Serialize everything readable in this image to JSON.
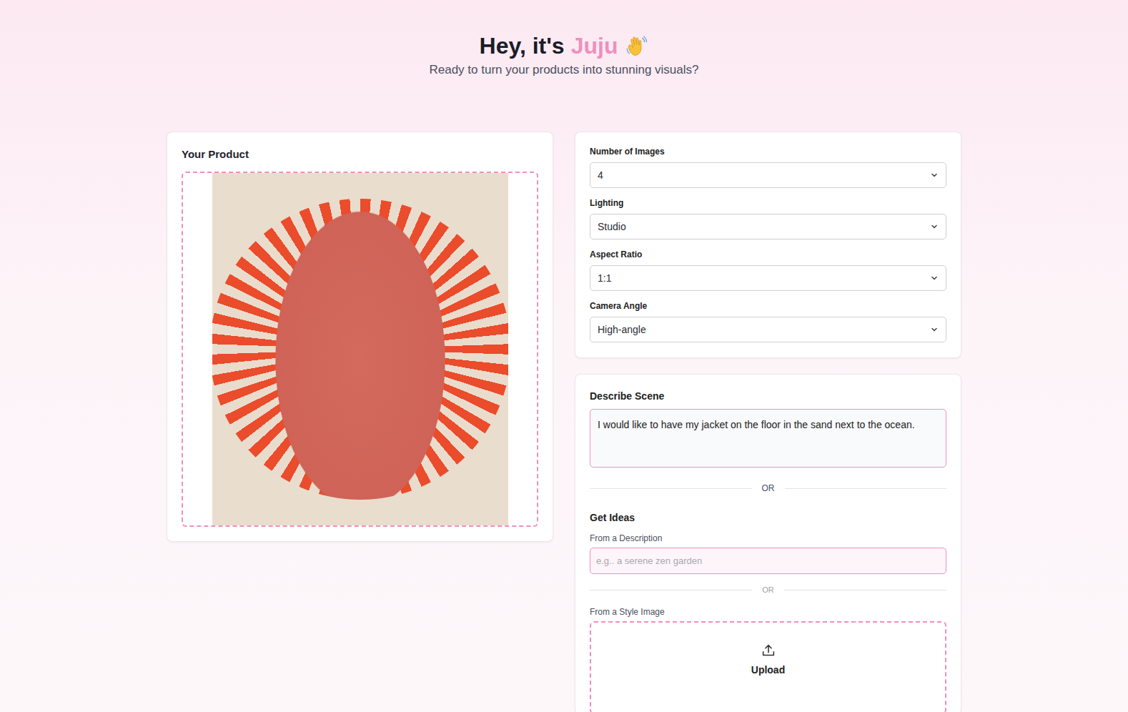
{
  "header": {
    "greeting": "Hey, it's",
    "name": "Juju",
    "subtitle": "Ready to turn your products into stunning visuals?"
  },
  "product": {
    "title": "Your Product"
  },
  "settings": [
    {
      "label": "Number of Images",
      "value": "4"
    },
    {
      "label": "Lighting",
      "value": "Studio"
    },
    {
      "label": "Aspect Ratio",
      "value": "1:1"
    },
    {
      "label": "Camera Angle",
      "value": "High-angle"
    }
  ],
  "scene": {
    "title": "Describe Scene",
    "value": "I would like to have my jacket on the floor in the sand next to the ocean.",
    "divider": "OR"
  },
  "ideas": {
    "title": "Get Ideas",
    "description_label": "From a Description",
    "placeholder": "e.g.. a serene zen garden",
    "divider": "OR",
    "style_label": "From a Style Image",
    "upload": "Upload"
  }
}
